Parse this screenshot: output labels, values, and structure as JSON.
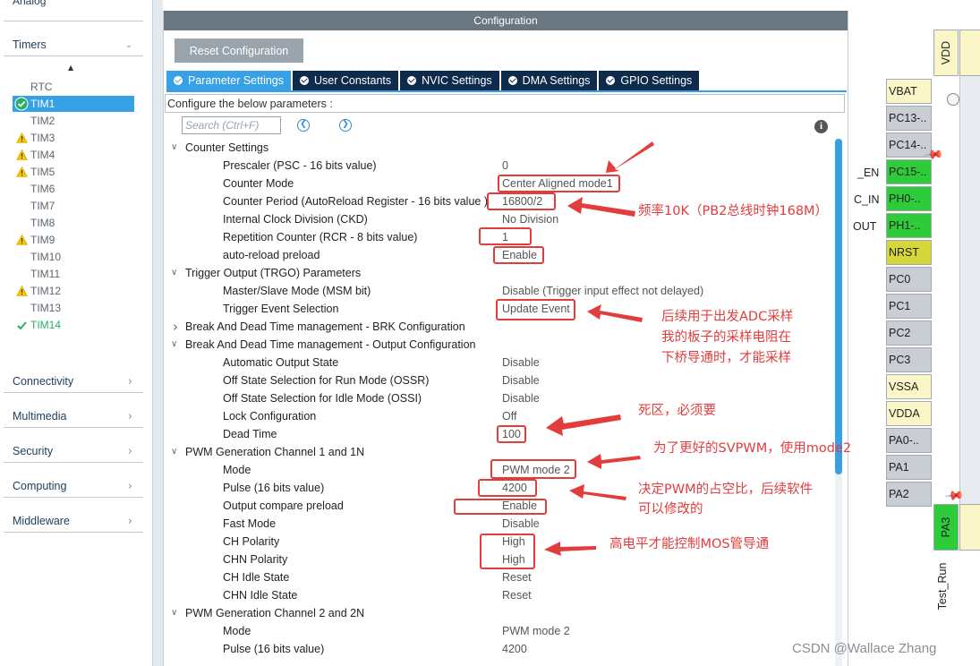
{
  "sidebar": {
    "analog_label": "Analog",
    "timers_label": "Timers",
    "timers": [
      {
        "label": "RTC",
        "status": "none"
      },
      {
        "label": "TIM1",
        "status": "selected"
      },
      {
        "label": "TIM2",
        "status": "none"
      },
      {
        "label": "TIM3",
        "status": "warning"
      },
      {
        "label": "TIM4",
        "status": "warning"
      },
      {
        "label": "TIM5",
        "status": "warning"
      },
      {
        "label": "TIM6",
        "status": "none"
      },
      {
        "label": "TIM7",
        "status": "none"
      },
      {
        "label": "TIM8",
        "status": "none"
      },
      {
        "label": "TIM9",
        "status": "warning"
      },
      {
        "label": "TIM10",
        "status": "none"
      },
      {
        "label": "TIM11",
        "status": "none"
      },
      {
        "label": "TIM12",
        "status": "warning"
      },
      {
        "label": "TIM13",
        "status": "none"
      },
      {
        "label": "TIM14",
        "status": "enabled"
      }
    ],
    "categories": [
      "Connectivity",
      "Multimedia",
      "Security",
      "Computing",
      "Middleware"
    ]
  },
  "panel": {
    "title": "Configuration",
    "reset_label": "Reset Configuration",
    "tabs": [
      "Parameter Settings",
      "User Constants",
      "NVIC Settings",
      "DMA Settings",
      "GPIO Settings"
    ],
    "configure_text": "Configure the below parameters :",
    "search_placeholder": "Search (Ctrl+F)"
  },
  "tree": [
    {
      "type": "group",
      "label": "Counter Settings",
      "expanded": true
    },
    {
      "type": "param",
      "name": "Prescaler (PSC - 16 bits value)",
      "value": "0"
    },
    {
      "type": "param",
      "name": "Counter Mode",
      "value": "Center Aligned mode1"
    },
    {
      "type": "param",
      "name": "Counter Period (AutoReload Register - 16 bits value )",
      "value": "16800/2"
    },
    {
      "type": "param",
      "name": "Internal Clock Division (CKD)",
      "value": "No Division"
    },
    {
      "type": "param",
      "name": "Repetition Counter (RCR - 8 bits value)",
      "value": "1"
    },
    {
      "type": "param",
      "name": "auto-reload preload",
      "value": "Enable"
    },
    {
      "type": "group",
      "label": "Trigger Output (TRGO) Parameters",
      "expanded": true
    },
    {
      "type": "param",
      "name": "Master/Slave Mode (MSM bit)",
      "value": "Disable (Trigger input effect not delayed)"
    },
    {
      "type": "param",
      "name": "Trigger Event Selection",
      "value": "Update Event"
    },
    {
      "type": "group",
      "label": "Break And Dead Time management - BRK Configuration",
      "expanded": false
    },
    {
      "type": "group",
      "label": "Break And Dead Time management - Output Configuration",
      "expanded": true
    },
    {
      "type": "param",
      "name": "Automatic Output State",
      "value": "Disable"
    },
    {
      "type": "param",
      "name": "Off State Selection for Run Mode (OSSR)",
      "value": "Disable"
    },
    {
      "type": "param",
      "name": "Off State Selection for Idle Mode (OSSI)",
      "value": "Disable"
    },
    {
      "type": "param",
      "name": "Lock Configuration",
      "value": "Off"
    },
    {
      "type": "param",
      "name": "Dead Time",
      "value": "100"
    },
    {
      "type": "group",
      "label": "PWM Generation Channel 1 and 1N",
      "expanded": true
    },
    {
      "type": "param",
      "name": "Mode",
      "value": "PWM mode 2"
    },
    {
      "type": "param",
      "name": "Pulse (16 bits value)",
      "value": "4200"
    },
    {
      "type": "param",
      "name": "Output compare preload",
      "value": "Enable"
    },
    {
      "type": "param",
      "name": "Fast Mode",
      "value": "Disable"
    },
    {
      "type": "param",
      "name": "CH Polarity",
      "value": "High"
    },
    {
      "type": "param",
      "name": "CHN Polarity",
      "value": "High"
    },
    {
      "type": "param",
      "name": "CH Idle State",
      "value": "Reset"
    },
    {
      "type": "param",
      "name": "CHN Idle State",
      "value": "Reset"
    },
    {
      "type": "group",
      "label": "PWM Generation Channel 2 and 2N",
      "expanded": true
    },
    {
      "type": "param",
      "name": "Mode",
      "value": "PWM mode 2"
    },
    {
      "type": "param",
      "name": "Pulse (16 bits value)",
      "value": "4200"
    }
  ],
  "annotations": [
    "频率10K（PB2总线时钟168M）",
    "后续用于出发ADC采样",
    "我的板子的采样电阻在",
    "下桥导通时，才能采样",
    "死区，必须要",
    "为了更好的SVPWM，使用mode2",
    "决定PWM的占空比，后续软件",
    "可以修改的",
    "高电平才能控制MOS管导通"
  ],
  "chip": {
    "top_pins": [
      "VDD"
    ],
    "pins": [
      {
        "label": "VBAT",
        "color": "#fbf6c8"
      },
      {
        "label": "PC13-..",
        "color": "#c8ced4"
      },
      {
        "label": "PC14-..",
        "color": "#c8ced4"
      },
      {
        "label": "PC15-..",
        "color": "#2ecc3a"
      },
      {
        "label": "PH0-..",
        "color": "#2ecc3a"
      },
      {
        "label": "PH1-..",
        "color": "#2ecc3a"
      },
      {
        "label": "NRST",
        "color": "#d6d63a"
      },
      {
        "label": "PC0",
        "color": "#c8ced4"
      },
      {
        "label": "PC1",
        "color": "#c8ced4"
      },
      {
        "label": "PC2",
        "color": "#c8ced4"
      },
      {
        "label": "PC3",
        "color": "#c8ced4"
      },
      {
        "label": "VSSA",
        "color": "#fbf6c8"
      },
      {
        "label": "VDDA",
        "color": "#fbf6c8"
      },
      {
        "label": "PA0-..",
        "color": "#c8ced4"
      },
      {
        "label": "PA1",
        "color": "#c8ced4"
      },
      {
        "label": "PA2",
        "color": "#c8ced4"
      }
    ],
    "bottom_pin": "PA3",
    "bottom_label": "Test_Run",
    "side_labels": [
      "_EN",
      "C_IN",
      "OUT"
    ]
  },
  "watermark": "CSDN @Wallace Zhang",
  "colors": {
    "accent": "#38a1e6",
    "tab_dark": "#0f2b4c",
    "annotation": "#e23c3c",
    "warning": "#f2c500",
    "ok": "#2bae65"
  }
}
